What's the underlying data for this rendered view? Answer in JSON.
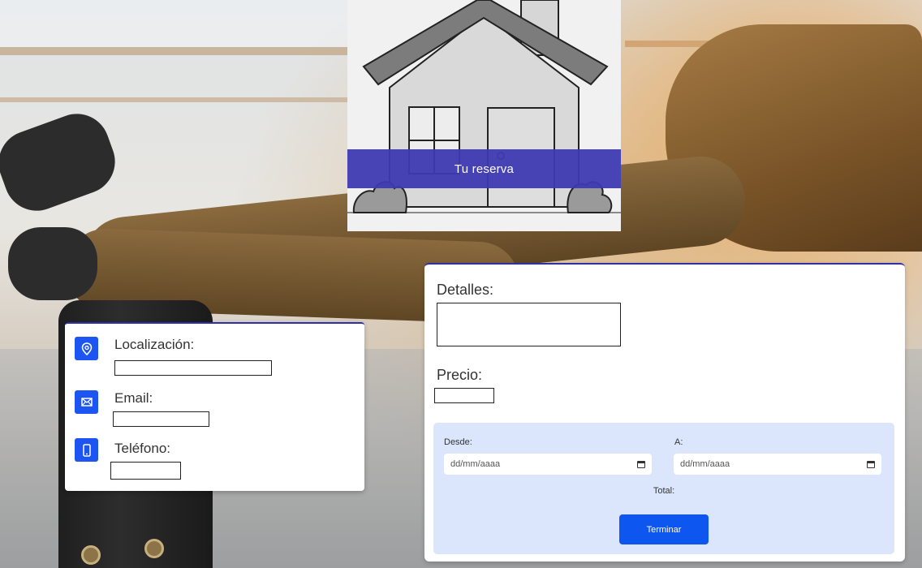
{
  "hero": {
    "title": "Tu reserva"
  },
  "contact": {
    "location_label": "Localización:",
    "email_label": "Email:",
    "phone_label": "Teléfono:",
    "icons": [
      "map-pin-icon",
      "mail-icon",
      "phone-icon"
    ]
  },
  "details": {
    "details_label": "Detalles:",
    "price_label": "Precio:",
    "from_label": "Desde:",
    "to_label": "A:",
    "from_placeholder": "dd/mm/aaaa",
    "to_placeholder": "dd/mm/aaaa",
    "total_label": "Total:",
    "finish_button": "Terminar"
  },
  "colors": {
    "accent_blue": "#1c55f2",
    "hero_band": "#3e3ab2",
    "booking_panel": "#dbe6fd"
  }
}
